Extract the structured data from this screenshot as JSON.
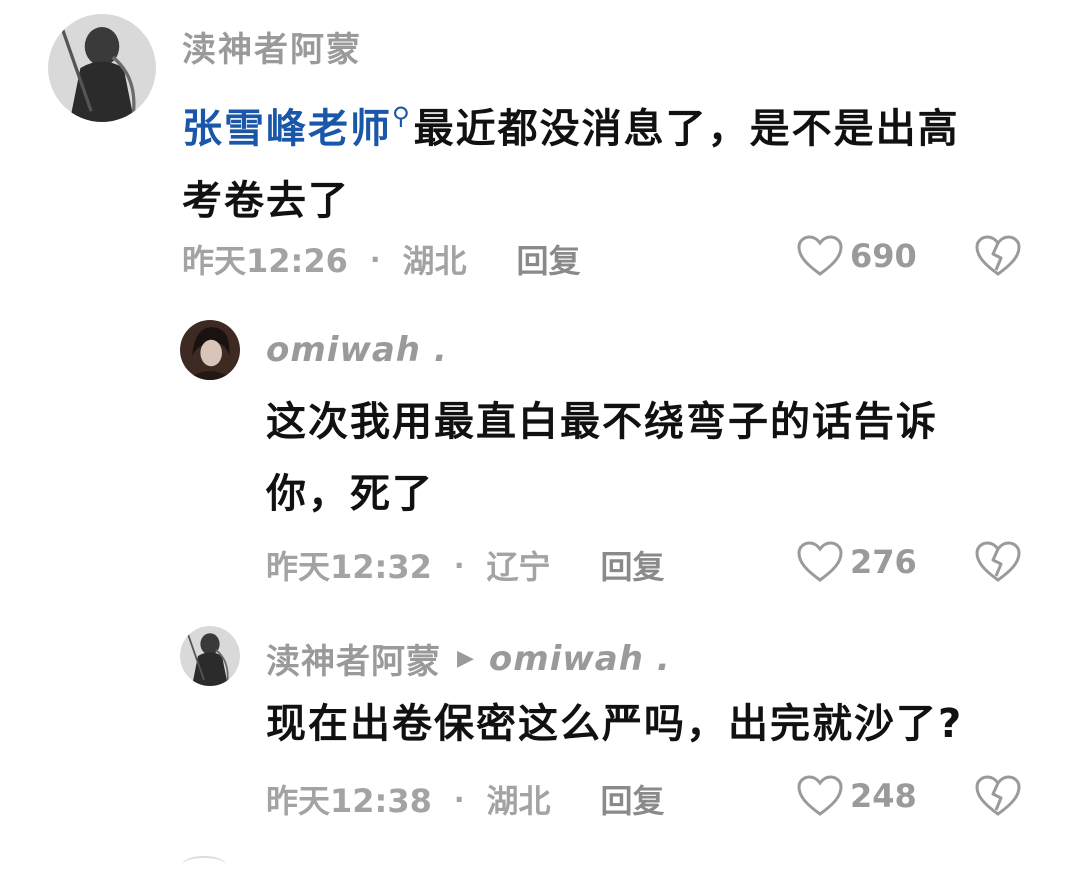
{
  "comments": [
    {
      "author": "渎神者阿蒙",
      "mention": "张雪峰老师",
      "text_line1": "最近都没消息了，是不是出高",
      "text_line2": "考卷去了",
      "time": "昨天12:26",
      "location": "湖北",
      "reply_label": "回复",
      "likes": "690"
    },
    {
      "author": "omiwah .",
      "text_line1": "这次我用最直白最不绕弯子的话告诉",
      "text_line2": "你，死了",
      "time": "昨天12:32",
      "location": "辽宁",
      "reply_label": "回复",
      "likes": "276"
    },
    {
      "author": "渎神者阿蒙",
      "reply_to": "omiwah .",
      "text_line1": "现在出卷保密这么严吗，出完就沙了?",
      "time": "昨天12:38",
      "location": "湖北",
      "reply_label": "回复",
      "likes": "248"
    }
  ],
  "separator": "·",
  "icons": {
    "like": "heart-outline-icon",
    "dislike": "broken-heart-icon",
    "mention": "search-icon"
  },
  "colors": {
    "mention": "#1a57a8",
    "text": "#111111",
    "meta": "#a3a3a3"
  }
}
